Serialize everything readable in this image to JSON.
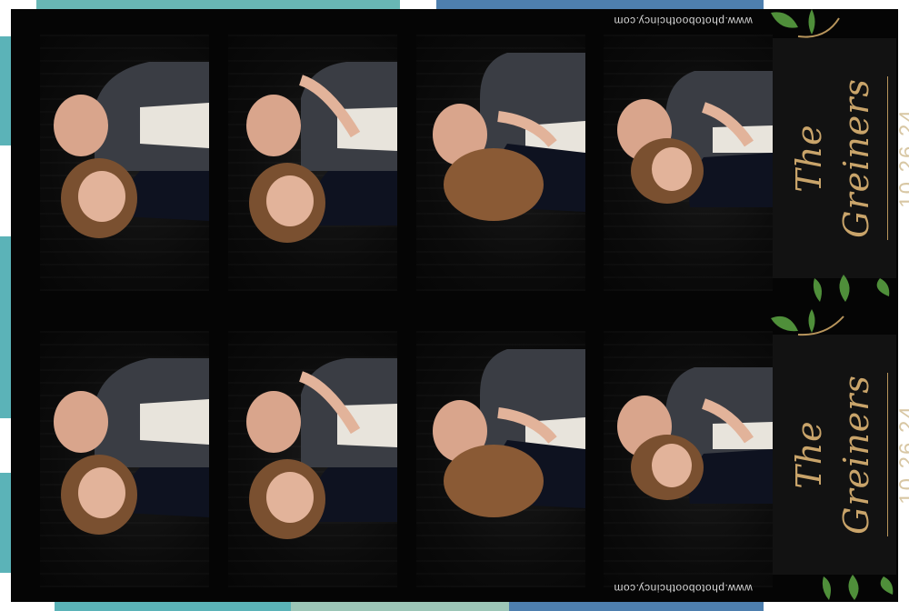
{
  "sheet": {
    "couple_name": "The Greiners",
    "date": "10.26.24",
    "website": "www.photoboothcincy.com"
  },
  "strips": [
    {
      "id": "strip-1",
      "photos": [
        "photo-1",
        "photo-2",
        "photo-3",
        "photo-4"
      ]
    },
    {
      "id": "strip-2",
      "photos": [
        "photo-1",
        "photo-2",
        "photo-3",
        "photo-4"
      ]
    }
  ],
  "colors": {
    "background": "#050505",
    "card": "#121212",
    "gold": "#c9a46a",
    "teal_edge": "#5bb3b8",
    "blue_edge": "#4a7fb0",
    "leaf_green": "#4f8f3a"
  }
}
